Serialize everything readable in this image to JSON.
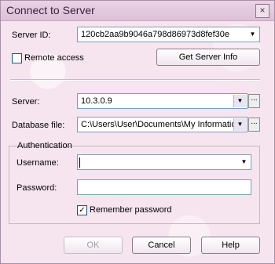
{
  "window": {
    "title": "Connect to Server",
    "close_glyph": "×"
  },
  "server_id": {
    "label": "Server ID:",
    "value": "120cb2aa9b9046a798d86973d8fef30e"
  },
  "remote_access": {
    "label": "Remote access",
    "checked": false
  },
  "get_server_info_label": "Get Server Info",
  "server": {
    "label": "Server:",
    "value": "10.3.0.9"
  },
  "database_file": {
    "label": "Database file:",
    "value": "C:\\Users\\User\\Documents\\My Information."
  },
  "authentication": {
    "title": "Authentication",
    "username": {
      "label": "Username:",
      "value": ""
    },
    "password": {
      "label": "Password:",
      "value": ""
    },
    "remember_password": {
      "label": "Remember password",
      "checked": true
    }
  },
  "buttons": {
    "ok": "OK",
    "cancel": "Cancel",
    "help": "Help"
  },
  "icons": {
    "dropdown": "▼",
    "browse": "..."
  },
  "colors": {
    "background": "#f6e4ef",
    "field_border": "#7f9db9"
  }
}
